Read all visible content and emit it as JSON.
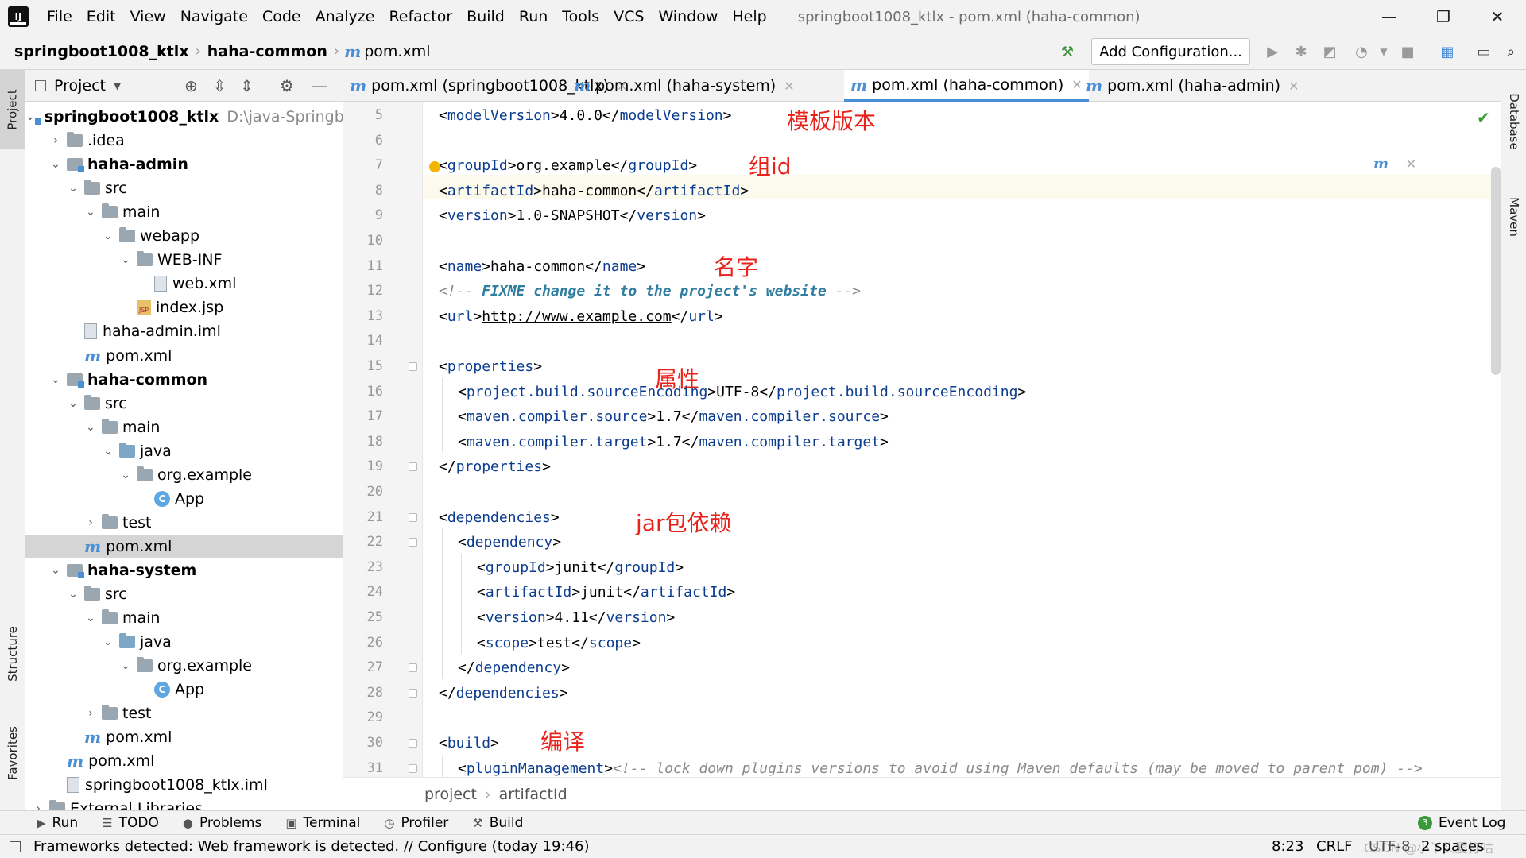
{
  "menubar": {
    "items": [
      "File",
      "Edit",
      "View",
      "Navigate",
      "Code",
      "Analyze",
      "Refactor",
      "Build",
      "Run",
      "Tools",
      "VCS",
      "Window",
      "Help"
    ],
    "window_title": "springboot1008_ktlx - pom.xml (haha-common)"
  },
  "navbar": {
    "crumbs": [
      "springboot1008_ktlx",
      "haha-common",
      "pom.xml"
    ],
    "add_configuration": "Add Configuration..."
  },
  "left_strip": {
    "project": "Project",
    "structure": "Structure",
    "favorites": "Favorites"
  },
  "right_strip": {
    "database": "Database",
    "maven": "Maven"
  },
  "project_panel": {
    "title": "Project",
    "tree": [
      {
        "label": "springboot1008_ktlx",
        "hint": "D:\\java-Springb",
        "bold": true
      },
      {
        "label": ".idea"
      },
      {
        "label": "haha-admin",
        "bold": true
      },
      {
        "label": "src"
      },
      {
        "label": "main"
      },
      {
        "label": "webapp"
      },
      {
        "label": "WEB-INF"
      },
      {
        "label": "web.xml"
      },
      {
        "label": "index.jsp"
      },
      {
        "label": "haha-admin.iml"
      },
      {
        "label": "pom.xml"
      },
      {
        "label": "haha-common",
        "bold": true
      },
      {
        "label": "src"
      },
      {
        "label": "main"
      },
      {
        "label": "java"
      },
      {
        "label": "org.example"
      },
      {
        "label": "App"
      },
      {
        "label": "test"
      },
      {
        "label": "pom.xml"
      },
      {
        "label": "haha-system",
        "bold": true
      },
      {
        "label": "src"
      },
      {
        "label": "main"
      },
      {
        "label": "java"
      },
      {
        "label": "org.example"
      },
      {
        "label": "App"
      },
      {
        "label": "test"
      },
      {
        "label": "pom.xml"
      },
      {
        "label": "pom.xml"
      },
      {
        "label": "springboot1008_ktlx.iml"
      },
      {
        "label": "External Libraries"
      }
    ]
  },
  "tabs": [
    {
      "label": "pom.xml (springboot1008_ktlx)"
    },
    {
      "label": "pom.xml (haha-system)"
    },
    {
      "label": "pom.xml (haha-common)"
    },
    {
      "label": "pom.xml (haha-admin)"
    }
  ],
  "editor": {
    "line_numbers": [
      "5",
      "6",
      "7",
      "8",
      "9",
      "10",
      "11",
      "12",
      "13",
      "14",
      "15",
      "16",
      "17",
      "18",
      "19",
      "20",
      "21",
      "22",
      "23",
      "24",
      "25",
      "26",
      "27",
      "28",
      "29",
      "30",
      "31"
    ],
    "annotations": {
      "template_version": "模板版本",
      "group_id": "组id",
      "name": "名字",
      "properties": "属性",
      "jar_deps": "jar包依赖",
      "compile": "编译"
    }
  },
  "breadcrumb_bar": {
    "project": "project",
    "artifact": "artifactId"
  },
  "bottom_tools": {
    "run": "Run",
    "todo": "TODO",
    "problems": "Problems",
    "terminal": "Terminal",
    "profiler": "Profiler",
    "build": "Build",
    "event_log": "Event Log",
    "event_count": "3"
  },
  "status_bar": {
    "message": "Frameworks detected: Web framework is detected. // Configure (today 19:46)",
    "position": "8:23",
    "line_sep": "CRLF",
    "encoding": "UTF-8",
    "indent": "2 spaces",
    "watermark": "CSDN @小丫头爱打咕"
  }
}
